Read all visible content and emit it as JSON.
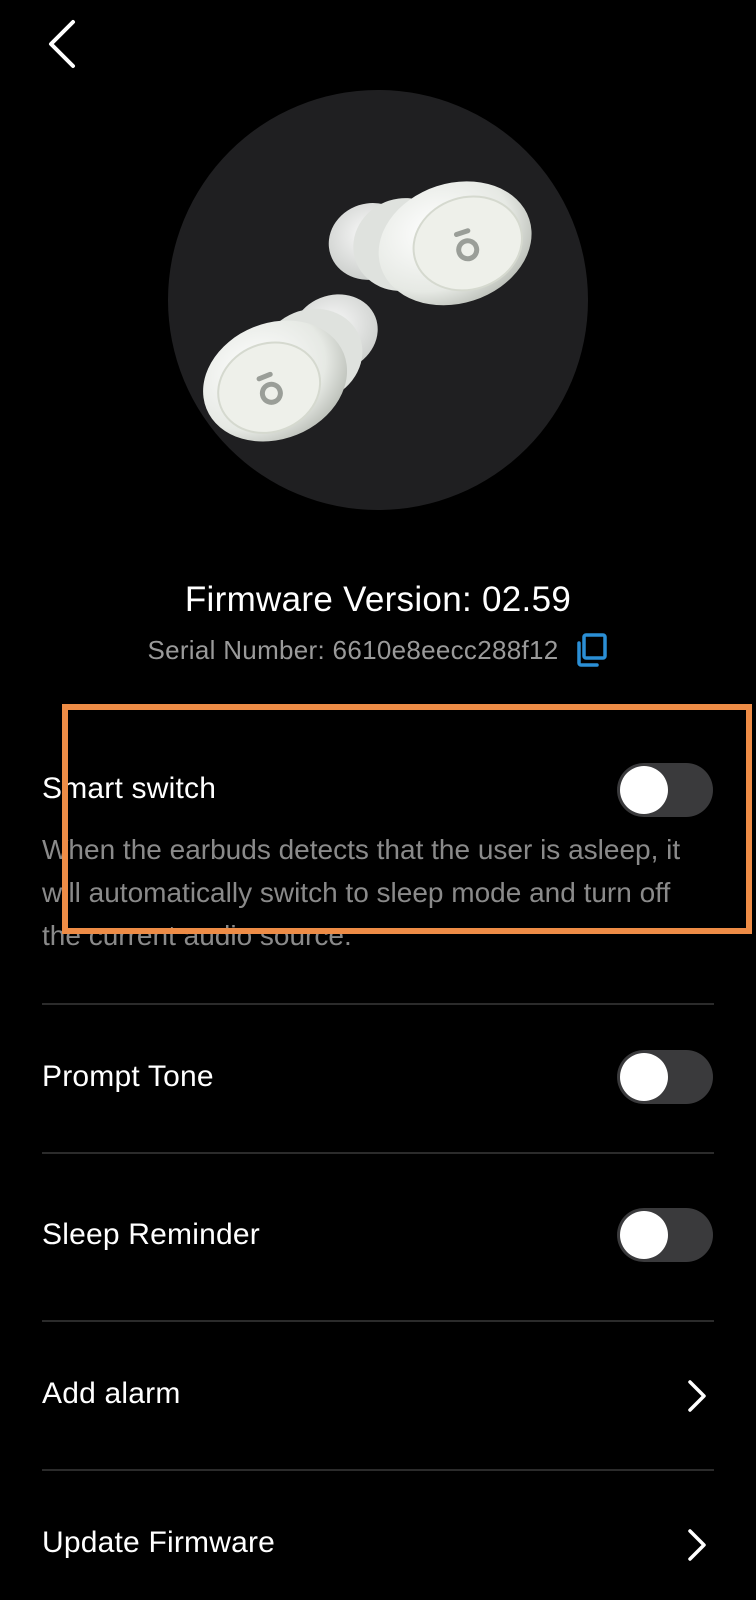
{
  "header": {
    "back_icon": "chevron-left-icon"
  },
  "device": {
    "image": "earbuds-image",
    "firmware_label": "Firmware Version: 02.59",
    "serial_label": "Serial Number: 6610e8eecc288f12",
    "copy_icon": "copy-icon"
  },
  "settings": {
    "smart_switch": {
      "label": "Smart switch",
      "description": "When the earbuds detects that the user is asleep, it will automatically switch to sleep mode and turn off the current audio source.",
      "enabled": false
    },
    "prompt_tone": {
      "label": "Prompt Tone",
      "enabled": false
    },
    "sleep_reminder": {
      "label": "Sleep Reminder",
      "enabled": false
    },
    "add_alarm": {
      "label": "Add alarm",
      "icon": "chevron-right-icon"
    },
    "update_firmware": {
      "label": "Update Firmware",
      "icon": "chevron-right-icon"
    }
  },
  "colors": {
    "background": "#000000",
    "accent_blue": "#2b8fd6",
    "highlight_orange": "#ee8c46",
    "toggle_track": "#3a3a3c",
    "muted_text": "#8a8a8a"
  }
}
